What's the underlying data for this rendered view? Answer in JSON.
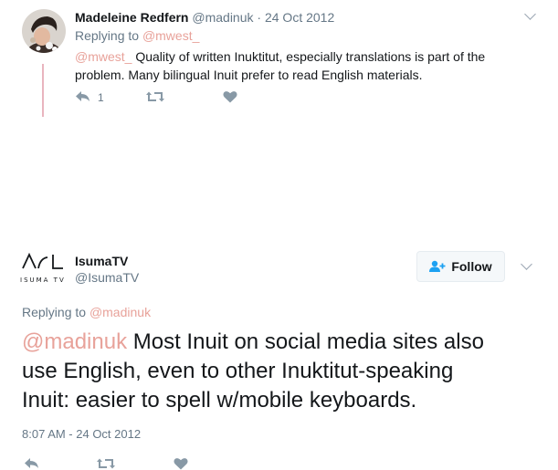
{
  "parent_tweet": {
    "author_name": "Madeleine Redfern",
    "author_handle": "@madinuk",
    "separator": "·",
    "date": "24 Oct 2012",
    "replying_to_prefix": "Replying to ",
    "replying_to_handle": "@mwest_",
    "mention": "@mwest_",
    "text_line1": " Quality of written Inuktitut, especially translations is part of the",
    "text_line2": "problem. Many bilingual Inuit prefer to read English materials.",
    "reply_count": "1",
    "icons": [
      "reply-icon",
      "retweet-icon",
      "like-icon",
      "chevron-down-icon"
    ]
  },
  "main_tweet": {
    "author_name": "IsumaTV",
    "author_handle": "@IsumaTV",
    "logo_glyphs": "ᐃᓱᒪ",
    "logo_subtext": "ISUMA TV",
    "follow_label": "Follow",
    "replying_to_prefix": "Replying to ",
    "replying_to_handle": "@madinuk",
    "mention": "@madinuk",
    "text_line1": " Most Inuit on social media sites also",
    "text_line2": "use English, even to other Inuktitut-speaking",
    "text_line3": "Inuit: easier to spell w/mobile keyboards.",
    "timestamp": "8:07 AM - 24 Oct 2012",
    "icons": [
      "reply-icon",
      "retweet-icon",
      "like-icon",
      "follow-user-icon",
      "chevron-down-icon"
    ]
  },
  "colors": {
    "mention": "#e8a29a",
    "muted": "#657786",
    "thread_line": "#e9b5bf",
    "text": "#14171a"
  }
}
